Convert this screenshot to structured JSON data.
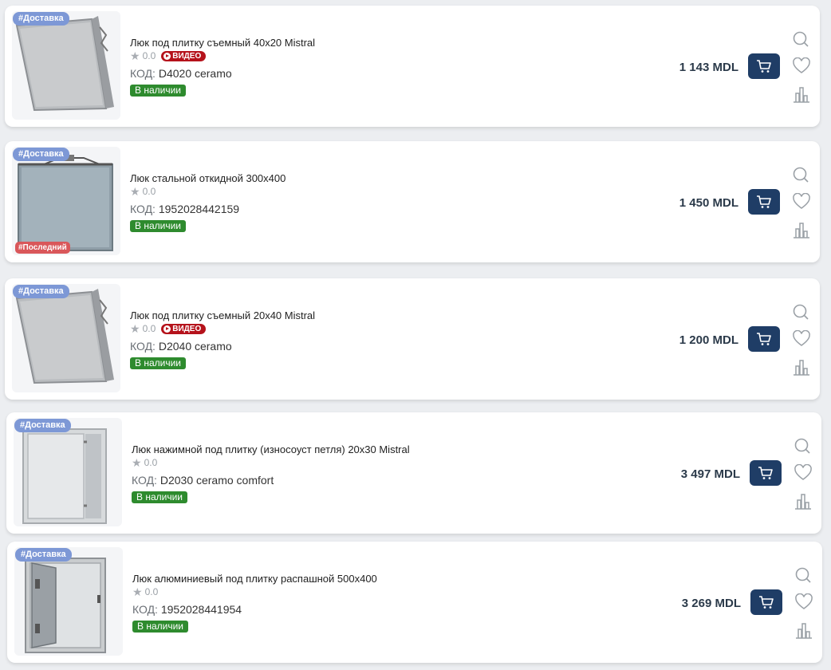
{
  "products": [
    {
      "tag_delivery": "#Доставка",
      "tag_last": "",
      "title": "Люк под плитку съемный 40х20 Mistral",
      "rating": "0.0",
      "video": "ВИДЕО",
      "code_label": "КОД:",
      "code": "D4020 ceramo",
      "stock": "В наличии",
      "price": "1 143  MDL",
      "image": "hatch-tilted"
    },
    {
      "tag_delivery": "#Доставка",
      "tag_last": "#Последний",
      "title": "Люк стальной откидной 300х400",
      "rating": "0.0",
      "video": "",
      "code_label": "КОД:",
      "code": "1952028442159",
      "stock": "В наличии",
      "price": "1 450  MDL",
      "image": "hatch-steel"
    },
    {
      "tag_delivery": "#Доставка",
      "tag_last": "",
      "title": "Люк под плитку съемный 20х40 Mistral",
      "rating": "0.0",
      "video": "ВИДЕО",
      "code_label": "КОД:",
      "code": "D2040 ceramo",
      "stock": "В наличии",
      "price": "1 200  MDL",
      "image": "hatch-tilted"
    },
    {
      "tag_delivery": "#Доставка",
      "tag_last": "",
      "title": "Люк нажимной под плитку (износоуст петля) 20х30 Mistral",
      "rating": "0.0",
      "video": "",
      "code_label": "КОД:",
      "code": "D2030 ceramo comfort",
      "stock": "В наличии",
      "price": "3 497  MDL",
      "image": "hatch-push"
    },
    {
      "tag_delivery": "#Доставка",
      "tag_last": "",
      "title": "Люк алюминиевый под плитку распашной 500х400",
      "rating": "0.0",
      "video": "",
      "code_label": "КОД:",
      "code": "1952028441954",
      "stock": "В наличии",
      "price": "3 269  MDL",
      "image": "hatch-aluminium"
    }
  ],
  "icons": {
    "search": "search-icon",
    "favorite": "heart-icon",
    "compare": "compare-icon",
    "cart": "cart-icon",
    "star": "star-icon",
    "play": "play-icon"
  },
  "colors": {
    "cart_button": "#1f3d66",
    "in_stock": "#2e8b2e",
    "delivery_tag": "#7d98d6",
    "last_tag": "#d9575a",
    "video_badge": "#b5121b"
  }
}
